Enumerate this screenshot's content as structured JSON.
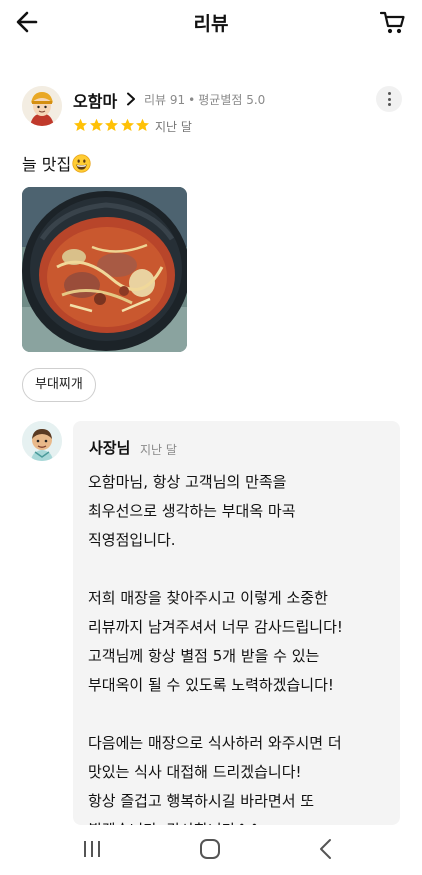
{
  "header": {
    "title": "리뷰",
    "back_icon": "arrow-left-icon",
    "cart_icon": "cart-icon"
  },
  "review": {
    "nickname": "오함마",
    "review_count": "리뷰 91",
    "separator": "•",
    "average_rating": "평균별점 5.0",
    "rating": 5,
    "date": "지난 달",
    "text": "늘 맛집",
    "emoji": "grinning-face-emoji",
    "menu_tag": "부대찌개",
    "star_color": "#FFC107"
  },
  "owner_reply": {
    "name": "사장님",
    "date": "지난 달",
    "lines": [
      "오함마님, 항상 고객님의 만족을",
      "최우선으로 생각하는 부대옥 마곡",
      "직영점입니다.",
      "",
      "저희 매장을 찾아주시고 이렇게 소중한",
      "리뷰까지 남겨주셔서 너무 감사드립니다!",
      "고객님께 항상 별점 5개 받을 수 있는",
      "부대옥이 될 수 있도록 노력하겠습니다!",
      "",
      "다음에는 매장으로 식사하러 와주시면 더",
      "맛있는 식사 대접해 드리겠습니다!",
      "항상 즐겁고 행복하시길 바라면서 또",
      "뵙겠습니다. 감사합니다^^"
    ]
  },
  "navbar": {
    "recent_icon": "recent-apps-icon",
    "home_icon": "home-icon",
    "back_icon": "nav-back-icon"
  }
}
